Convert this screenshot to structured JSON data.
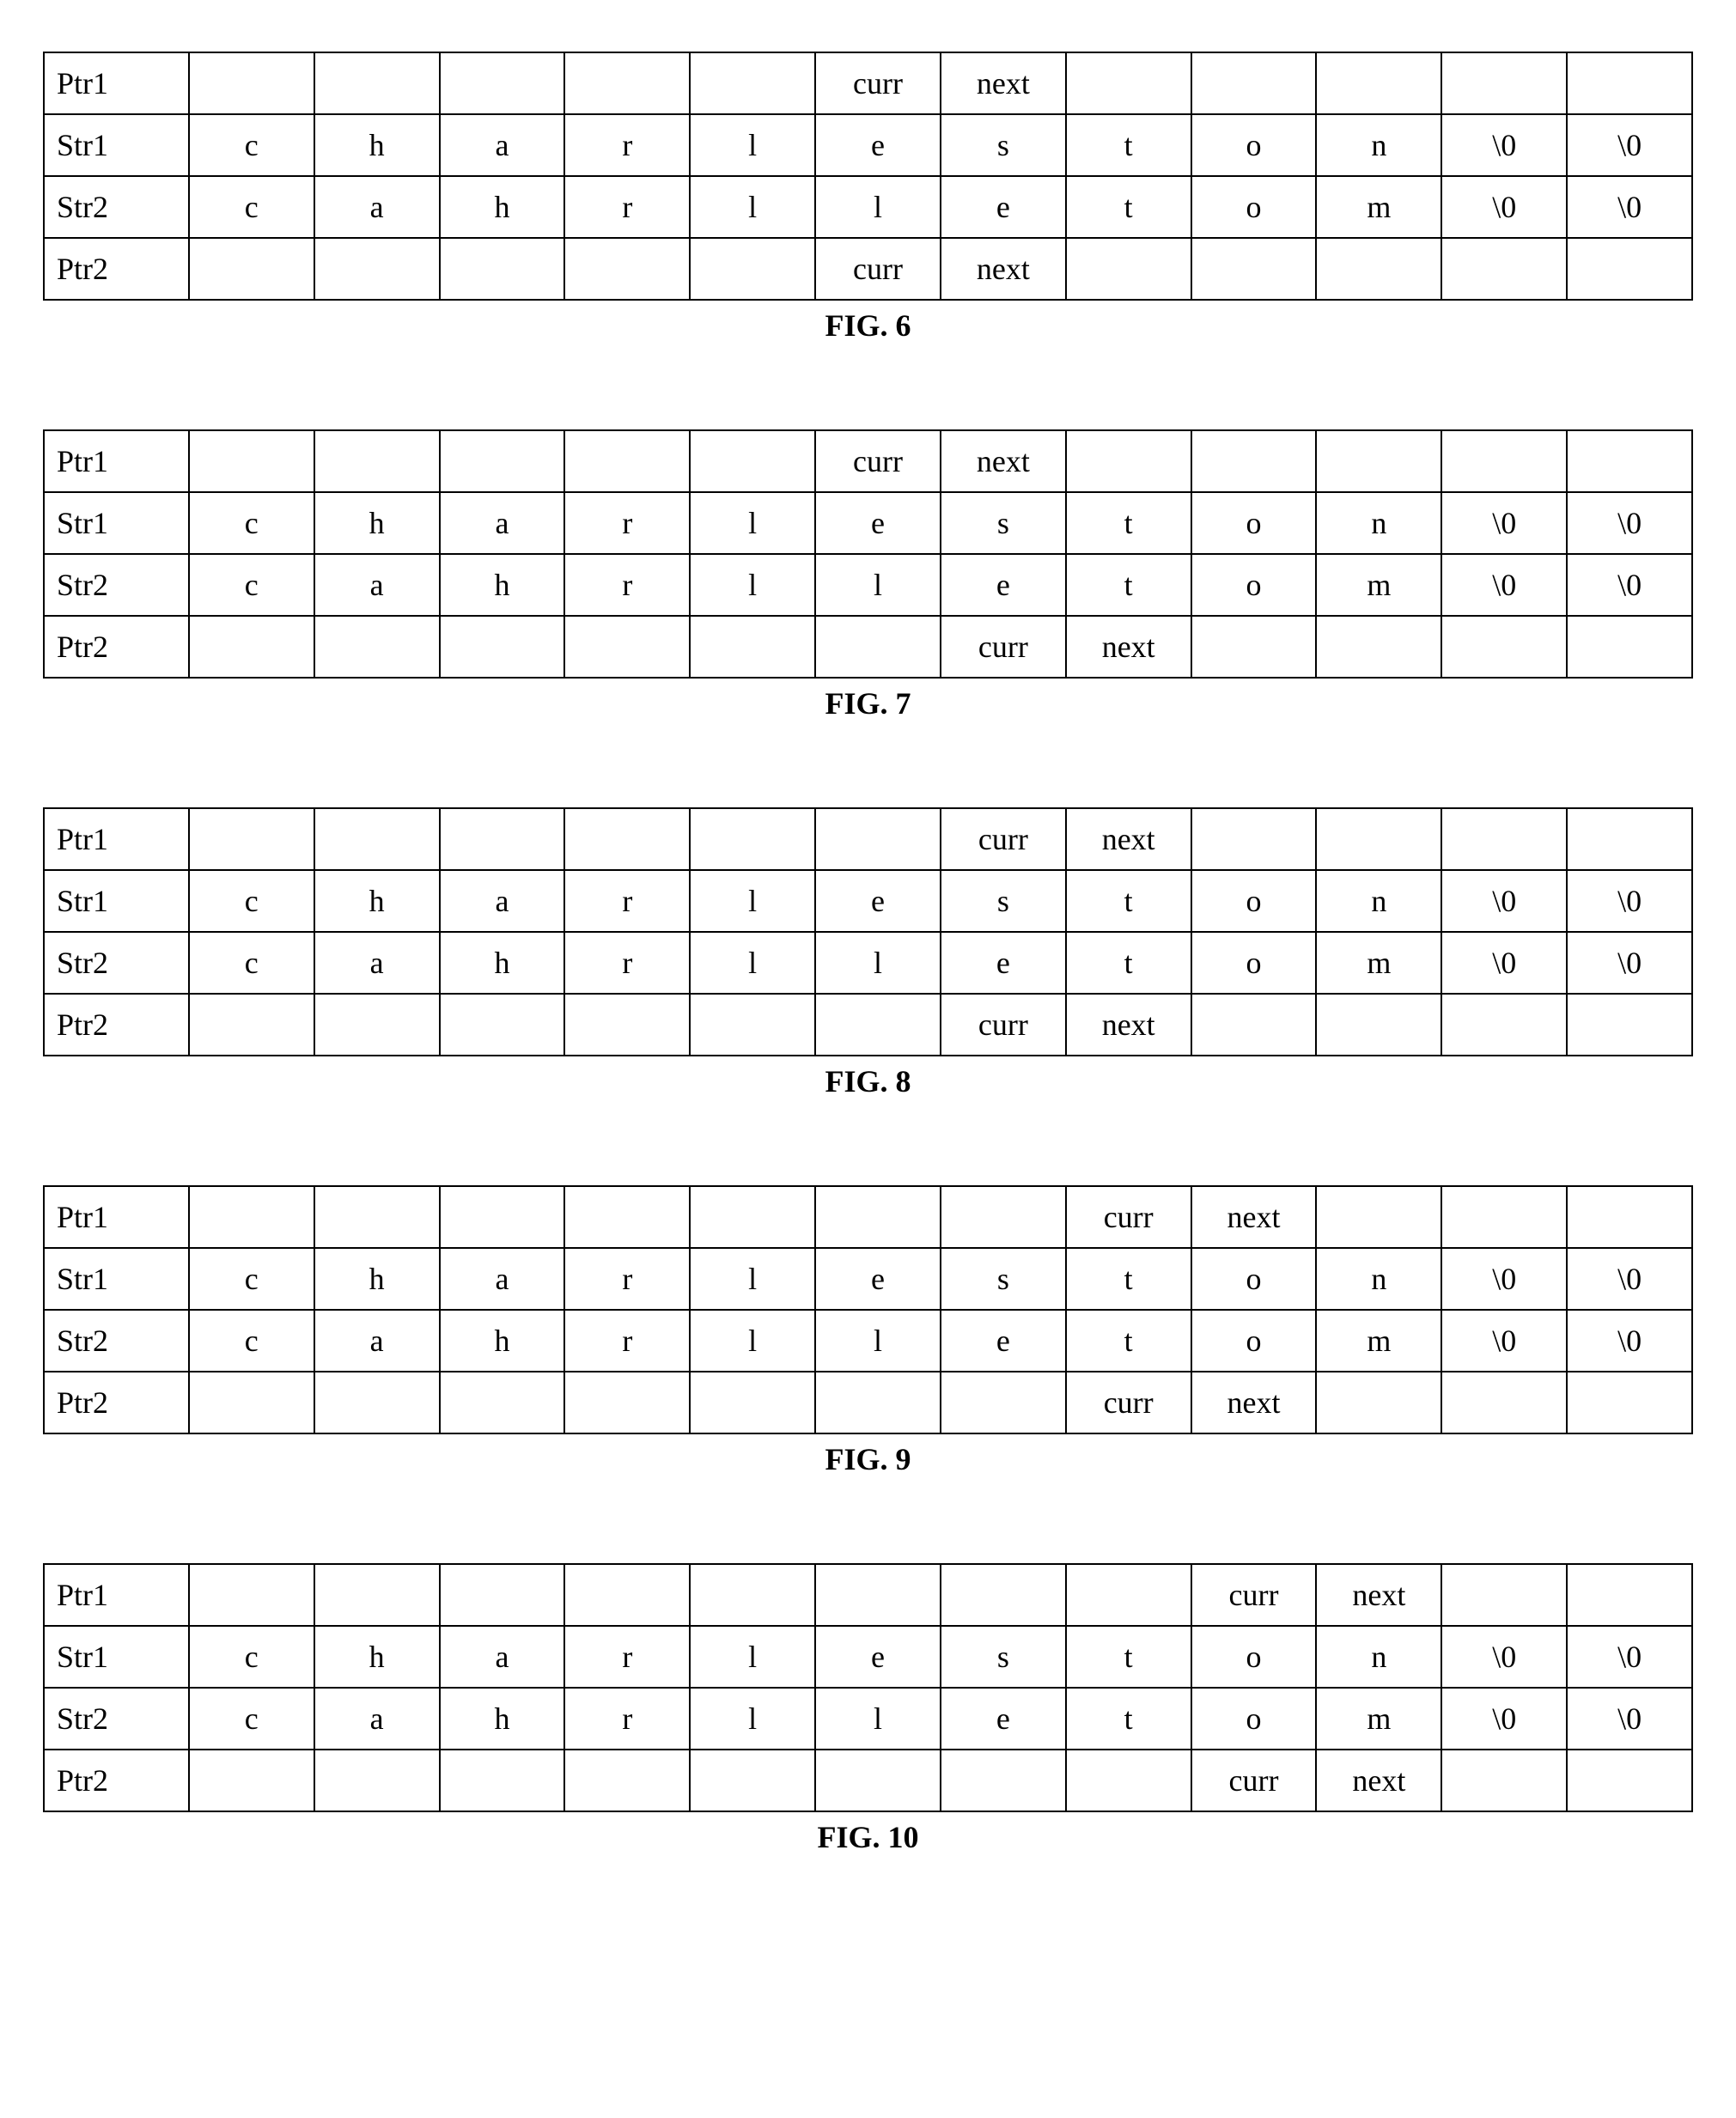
{
  "figures": [
    {
      "caption": "FIG. 6",
      "rows": [
        {
          "label": "Ptr1",
          "cells": [
            "",
            "",
            "",
            "",
            "",
            "curr",
            "next",
            "",
            "",
            "",
            "",
            ""
          ]
        },
        {
          "label": "Str1",
          "cells": [
            "c",
            "h",
            "a",
            "r",
            "l",
            "e",
            "s",
            "t",
            "o",
            "n",
            "\\0",
            "\\0"
          ]
        },
        {
          "label": "Str2",
          "cells": [
            "c",
            "a",
            "h",
            "r",
            "l",
            "l",
            "e",
            "t",
            "o",
            "m",
            "\\0",
            "\\0"
          ]
        },
        {
          "label": "Ptr2",
          "cells": [
            "",
            "",
            "",
            "",
            "",
            "curr",
            "next",
            "",
            "",
            "",
            "",
            ""
          ]
        }
      ]
    },
    {
      "caption": "FIG. 7",
      "rows": [
        {
          "label": "Ptr1",
          "cells": [
            "",
            "",
            "",
            "",
            "",
            "curr",
            "next",
            "",
            "",
            "",
            "",
            ""
          ]
        },
        {
          "label": "Str1",
          "cells": [
            "c",
            "h",
            "a",
            "r",
            "l",
            "e",
            "s",
            "t",
            "o",
            "n",
            "\\0",
            "\\0"
          ]
        },
        {
          "label": "Str2",
          "cells": [
            "c",
            "a",
            "h",
            "r",
            "l",
            "l",
            "e",
            "t",
            "o",
            "m",
            "\\0",
            "\\0"
          ]
        },
        {
          "label": "Ptr2",
          "cells": [
            "",
            "",
            "",
            "",
            "",
            "",
            "curr",
            "next",
            "",
            "",
            "",
            ""
          ]
        }
      ]
    },
    {
      "caption": "FIG. 8",
      "rows": [
        {
          "label": "Ptr1",
          "cells": [
            "",
            "",
            "",
            "",
            "",
            "",
            "curr",
            "next",
            "",
            "",
            "",
            ""
          ]
        },
        {
          "label": "Str1",
          "cells": [
            "c",
            "h",
            "a",
            "r",
            "l",
            "e",
            "s",
            "t",
            "o",
            "n",
            "\\0",
            "\\0"
          ]
        },
        {
          "label": "Str2",
          "cells": [
            "c",
            "a",
            "h",
            "r",
            "l",
            "l",
            "e",
            "t",
            "o",
            "m",
            "\\0",
            "\\0"
          ]
        },
        {
          "label": "Ptr2",
          "cells": [
            "",
            "",
            "",
            "",
            "",
            "",
            "curr",
            "next",
            "",
            "",
            "",
            ""
          ]
        }
      ]
    },
    {
      "caption": "FIG. 9",
      "rows": [
        {
          "label": "Ptr1",
          "cells": [
            "",
            "",
            "",
            "",
            "",
            "",
            "",
            "curr",
            "next",
            "",
            "",
            ""
          ]
        },
        {
          "label": "Str1",
          "cells": [
            "c",
            "h",
            "a",
            "r",
            "l",
            "e",
            "s",
            "t",
            "o",
            "n",
            "\\0",
            "\\0"
          ]
        },
        {
          "label": "Str2",
          "cells": [
            "c",
            "a",
            "h",
            "r",
            "l",
            "l",
            "e",
            "t",
            "o",
            "m",
            "\\0",
            "\\0"
          ]
        },
        {
          "label": "Ptr2",
          "cells": [
            "",
            "",
            "",
            "",
            "",
            "",
            "",
            "curr",
            "next",
            "",
            "",
            ""
          ]
        }
      ]
    },
    {
      "caption": "FIG. 10",
      "rows": [
        {
          "label": "Ptr1",
          "cells": [
            "",
            "",
            "",
            "",
            "",
            "",
            "",
            "",
            "curr",
            "next",
            "",
            ""
          ]
        },
        {
          "label": "Str1",
          "cells": [
            "c",
            "h",
            "a",
            "r",
            "l",
            "e",
            "s",
            "t",
            "o",
            "n",
            "\\0",
            "\\0"
          ]
        },
        {
          "label": "Str2",
          "cells": [
            "c",
            "a",
            "h",
            "r",
            "l",
            "l",
            "e",
            "t",
            "o",
            "m",
            "\\0",
            "\\0"
          ]
        },
        {
          "label": "Ptr2",
          "cells": [
            "",
            "",
            "",
            "",
            "",
            "",
            "",
            "",
            "curr",
            "next",
            "",
            ""
          ]
        }
      ]
    }
  ]
}
